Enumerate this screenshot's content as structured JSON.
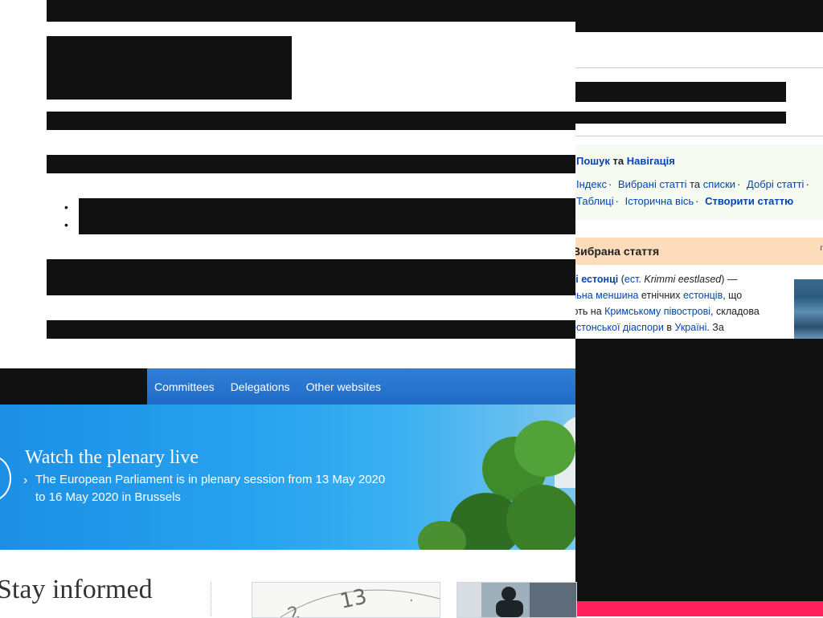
{
  "wiki": {
    "nav": {
      "search": "Пошук",
      "and": "та",
      "navigation": "Навігація",
      "row2": [
        {
          "text": "Індекс",
          "link": true
        },
        {
          "text": "Вибрані статті",
          "link": true
        },
        {
          "text": "та",
          "link": false
        },
        {
          "text": "списки",
          "link": true
        },
        {
          "text": "Добрі статті",
          "link": true
        }
      ],
      "row3": [
        {
          "text": "Таблиці",
          "link": true
        },
        {
          "text": "Історична вісь",
          "link": true
        },
        {
          "text": "Створити статтю",
          "link": true,
          "bold": true
        }
      ]
    },
    "featured": {
      "heading": "Вибрана стаття",
      "corner": "г",
      "lines": [
        [
          {
            "t": "кі естонці",
            "link": true,
            "bold": true
          },
          {
            "t": " ("
          },
          {
            "t": "ест.",
            "link": true
          },
          {
            "t": " Krimmi eestlased",
            "italic": true
          },
          {
            "t": ") —"
          }
        ],
        [
          {
            "t": "льна меншина",
            "link": true
          },
          {
            "t": " етнічних "
          },
          {
            "t": "естонців",
            "link": true
          },
          {
            "t": ", що"
          }
        ],
        [
          {
            "t": "ють на "
          },
          {
            "t": "Кримському півострові",
            "link": true
          },
          {
            "t": ", складова"
          }
        ],
        [
          {
            "t": "естонської діаспори",
            "link": true
          },
          {
            "t": " в "
          },
          {
            "t": "Україні",
            "link": true
          },
          {
            "t": ". За"
          }
        ]
      ]
    }
  },
  "ep": {
    "nav_items": [
      "Committees",
      "Delegations",
      "Other websites"
    ],
    "banner": {
      "title": "Watch the plenary live",
      "description": "The European Parliament is in plenary session from 13 May 2020 to 16 May 2020 in Brussels"
    },
    "stay_informed": "Stay informed"
  },
  "colors": {
    "wiki_link": "#0645ad",
    "featured_header": "#fddcbb",
    "ep_nav": "#2f7fd6",
    "accent_pink": "#ff1f5a"
  }
}
